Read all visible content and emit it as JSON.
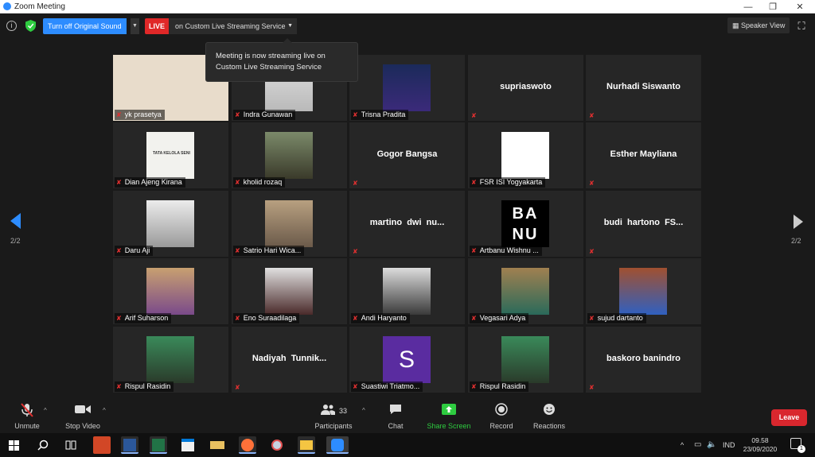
{
  "window": {
    "title": "Zoom Meeting",
    "controls": [
      "—",
      "❐",
      "✕"
    ]
  },
  "topbar": {
    "original_sound_label": "Turn off Original Sound",
    "live_badge": "LIVE",
    "live_service_label": "on Custom Live Streaming Service",
    "speaker_view_label": "Speaker View"
  },
  "tooltip": {
    "text": "Meeting is now streaming live on Custom Live Streaming Service"
  },
  "pagination": {
    "left_label": "2/2",
    "right_label": "2/2"
  },
  "participants": [
    {
      "name": "yk prasetya",
      "video": true
    },
    {
      "name": "Indra Gunawan",
      "video": true
    },
    {
      "name": "Trisna Pradita",
      "video": true
    },
    {
      "name": "supriaswoto",
      "video": false
    },
    {
      "name": "Nurhadi Siswanto",
      "video": false
    },
    {
      "name": "Dian Ajeng Kirana",
      "video": true
    },
    {
      "name": "kholid rozaq",
      "video": true
    },
    {
      "name": "Gogor Bangsa",
      "video": false
    },
    {
      "name": "FSR ISI Yogyakarta",
      "video": true
    },
    {
      "name": "Esther Mayliana",
      "video": false
    },
    {
      "name": "Daru Aji",
      "video": true
    },
    {
      "name": "Satrio Hari Wica...",
      "video": true
    },
    {
      "name": "martino  dwi  nu...",
      "video": false
    },
    {
      "name": "Artbanu Wishnu ...",
      "video": true
    },
    {
      "name": "budi  hartono  FS...",
      "video": false
    },
    {
      "name": "Arif Suharson",
      "video": true
    },
    {
      "name": "Eno Suraadilaga",
      "video": true
    },
    {
      "name": "Andi Haryanto",
      "video": true
    },
    {
      "name": "Vegasari Adya",
      "video": true
    },
    {
      "name": "sujud dartanto",
      "video": true
    },
    {
      "name": "Rispul Rasidin",
      "video": true
    },
    {
      "name": "Nadiyah  Tunnik...",
      "video": false
    },
    {
      "name": "Suastiwi Triatmo...",
      "video": true
    },
    {
      "name": "Rispul Rasidin",
      "video": true
    },
    {
      "name": "baskoro banindro",
      "video": false
    }
  ],
  "slide_text": "TATA KELOLA SENI",
  "avatar_letter": "S",
  "logo_text": "BANU",
  "toolbar": {
    "unmute": "Unmute",
    "stop_video": "Stop Video",
    "participants": "Participants",
    "participants_count": "33",
    "chat": "Chat",
    "share_screen": "Share Screen",
    "record": "Record",
    "reactions": "Reactions",
    "leave": "Leave"
  },
  "taskbar": {
    "tray_caret": "^",
    "ime": "IND",
    "time": "09.58",
    "date": "23/09/2020",
    "notifications": "1"
  },
  "colors": {
    "accent": "#2d8cff",
    "live": "#e02828",
    "leave": "#d9272e",
    "share": "#2ecc40"
  }
}
